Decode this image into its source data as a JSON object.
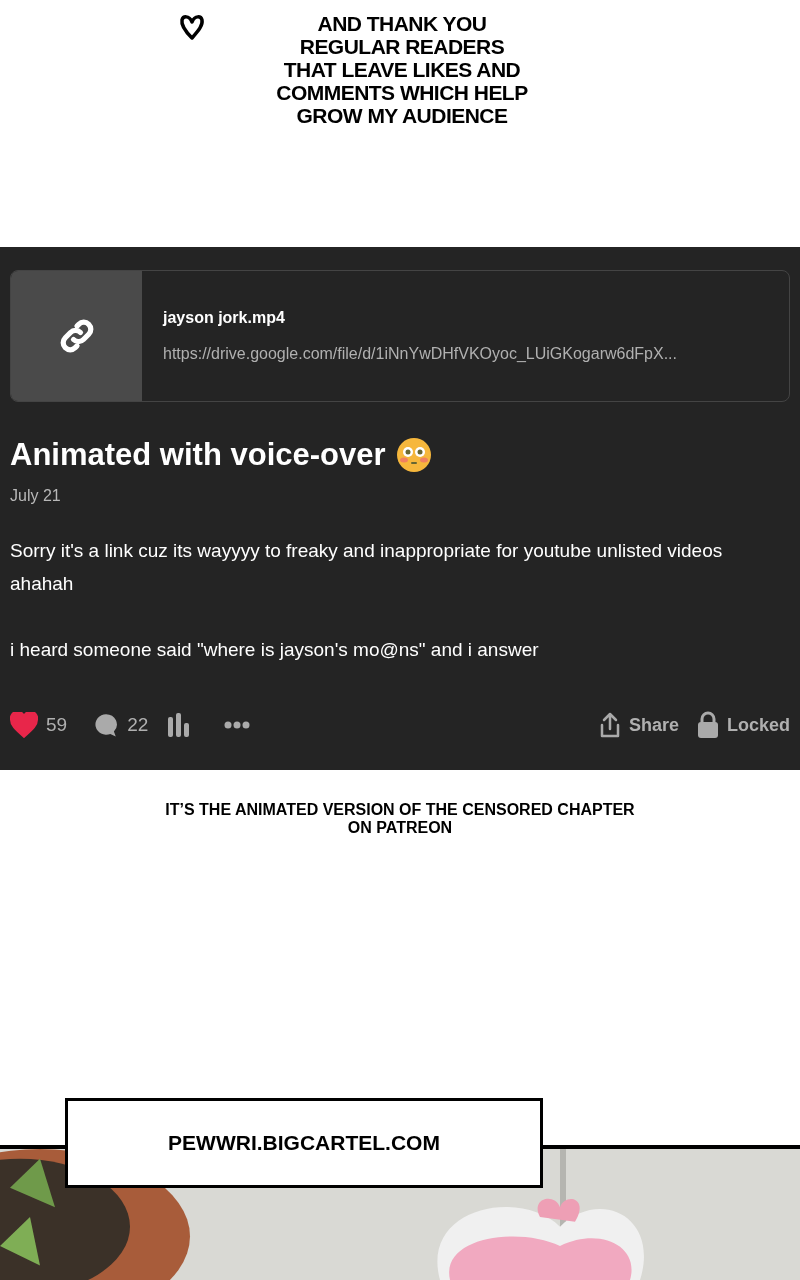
{
  "top_caption": [
    "AND THANK YOU",
    "REGULAR READERS",
    "THAT LEAVE LIKES AND",
    "COMMENTS WHICH HELP",
    "GROW MY AUDIENCE"
  ],
  "post": {
    "link_card": {
      "title": "jayson jork.mp4",
      "url": "https://drive.google.com/file/d/1iNnYwDHfVKOyoc_LUiGKogarw6dFpX..."
    },
    "title": "Animated with voice-over",
    "date": "July 21",
    "paragraphs": [
      "Sorry it's a link cuz its wayyyy to freaky and inappropriate for youtube unlisted videos ahahah",
      "i heard someone said \"where is jayson's mo@ns\" and i answer"
    ],
    "likes": {
      "count": "59",
      "liked": true
    },
    "comments": "22",
    "share": "Share",
    "locked": "Locked"
  },
  "middle_caption": [
    "IT’S THE ANIMATED VERSION OF THE CENSORED CHAPTER",
    "ON PATREON"
  ],
  "bottom_caption": "PEWWRI.BIGCARTEL.COM"
}
